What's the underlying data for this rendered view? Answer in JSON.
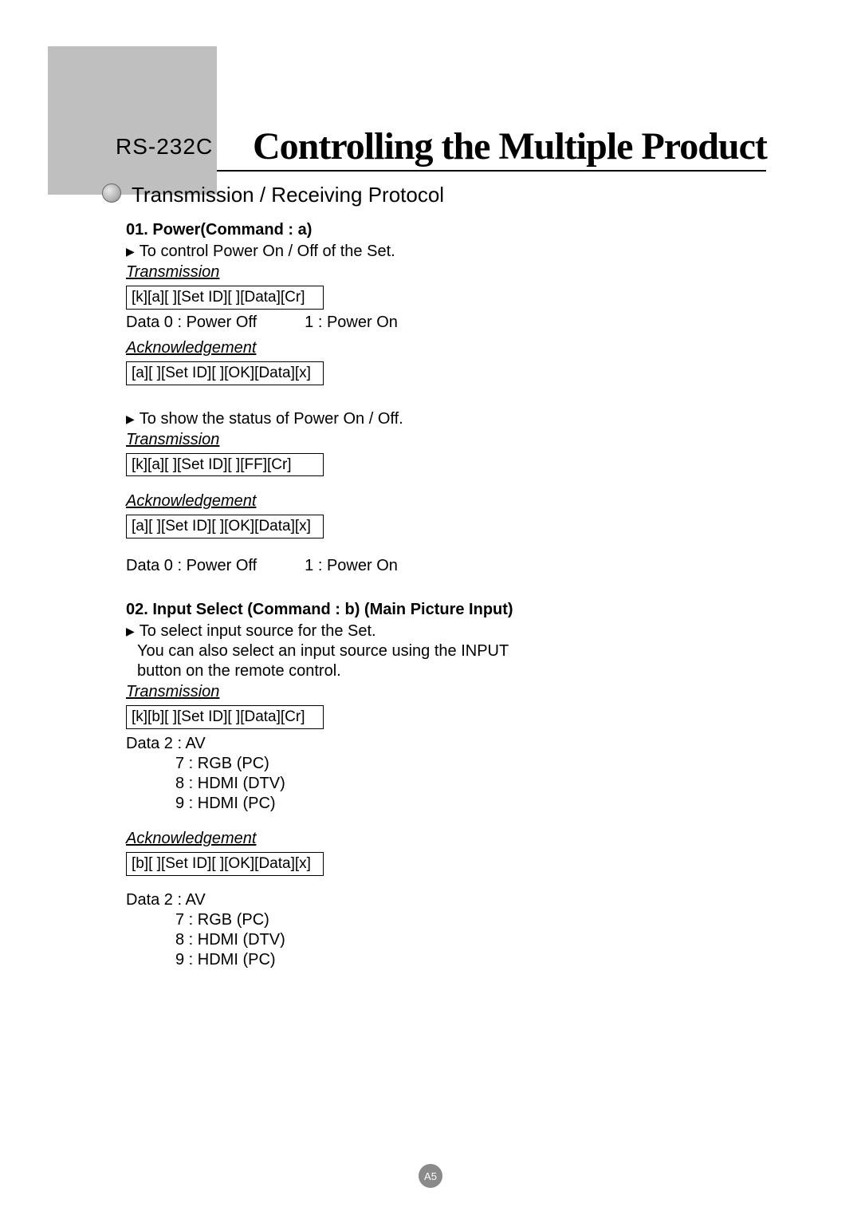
{
  "header": {
    "prefix": "RS-232C",
    "title": "Controlling the Multiple Product"
  },
  "section": {
    "title": "Transmission / Receiving Protocol"
  },
  "cmd01": {
    "heading": "01. Power(Command : a)",
    "desc": "To control Power On / Off of the Set.",
    "trans_label": "Transmission",
    "trans_code1": "[k][a][ ][Set ID][ ][Data][Cr]",
    "data_left": "Data 0 : Power Off",
    "data_right": "1 : Power On",
    "ack_label": "Acknowledgement",
    "ack_code1": "[a][ ][Set ID][ ][OK][Data][x]",
    "desc2": "To show the status of Power On / Off.",
    "trans_code2": "[k][a][ ][Set ID][ ][FF][Cr]",
    "ack_code2": "[a][ ][Set ID][ ][OK][Data][x]"
  },
  "cmd02": {
    "heading": "02. Input Select (Command : b) (Main Picture Input)",
    "desc_l1": "To select input source for the Set.",
    "desc_l2": "You can also select an input source using the INPUT",
    "desc_l3": "button on the remote control.",
    "trans_label": "Transmission",
    "trans_code": "[k][b][ ][Set ID][ ][Data][Cr]",
    "data1": "Data  2 : AV",
    "data2": "7 : RGB (PC)",
    "data3": "8 : HDMI (DTV)",
    "data4": "9 : HDMI (PC)",
    "ack_label": "Acknowledgement",
    "ack_code": "[b][ ][Set ID][ ][OK][Data][x]"
  },
  "page_number": "A5"
}
